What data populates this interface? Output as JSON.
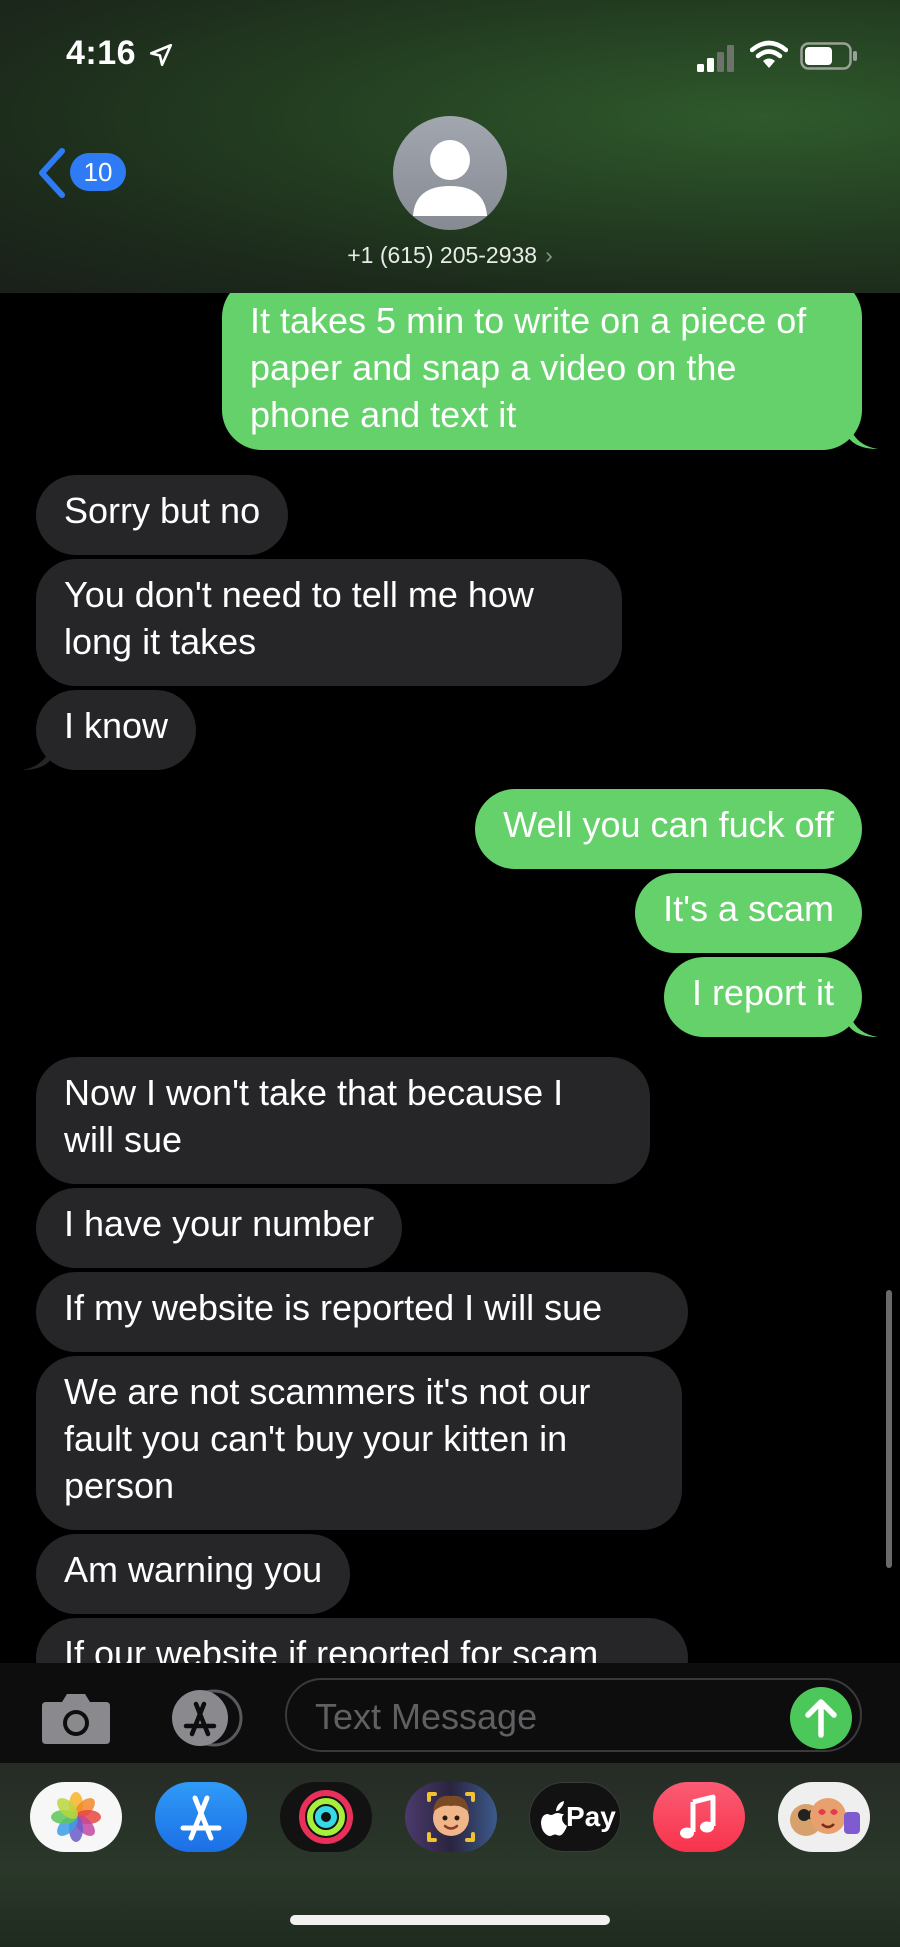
{
  "status_bar": {
    "time": "4:16"
  },
  "header": {
    "back_badge": "10",
    "contact": "+1 (615) 205-2938",
    "chevron": "›"
  },
  "messages": [
    {
      "from": "me",
      "text": "It takes 5 min to write on a piece of paper and snap a video on the phone and text it"
    },
    {
      "from": "them",
      "text": "Sorry but no"
    },
    {
      "from": "them",
      "text": "You don't need to tell me how long it takes"
    },
    {
      "from": "them",
      "text": "I know"
    },
    {
      "from": "me",
      "text": "Well you can fuck off"
    },
    {
      "from": "me",
      "text": "It's a scam"
    },
    {
      "from": "me",
      "text": "I report it"
    },
    {
      "from": "them",
      "text": "Now I won't take that because I will sue"
    },
    {
      "from": "them",
      "text": "I have your number"
    },
    {
      "from": "them",
      "text": "If my website is reported I will sue"
    },
    {
      "from": "them",
      "text": "We are not scammers it's not our fault you can't buy your kitten in person"
    },
    {
      "from": "them",
      "text": "Am warning you"
    },
    {
      "from": "them",
      "text": "If our website if reported for scam"
    }
  ],
  "input": {
    "placeholder": "Text Message"
  },
  "app_drawer": [
    "photos-icon",
    "app-store-icon",
    "fitness-icon",
    "memoji-icon",
    "apple-pay-icon",
    "music-icon",
    "animoji-icon"
  ],
  "pay_label": "Pay",
  "colors": {
    "sent": "#65d16a",
    "received": "#262628",
    "accent": "#2f7bf5"
  }
}
